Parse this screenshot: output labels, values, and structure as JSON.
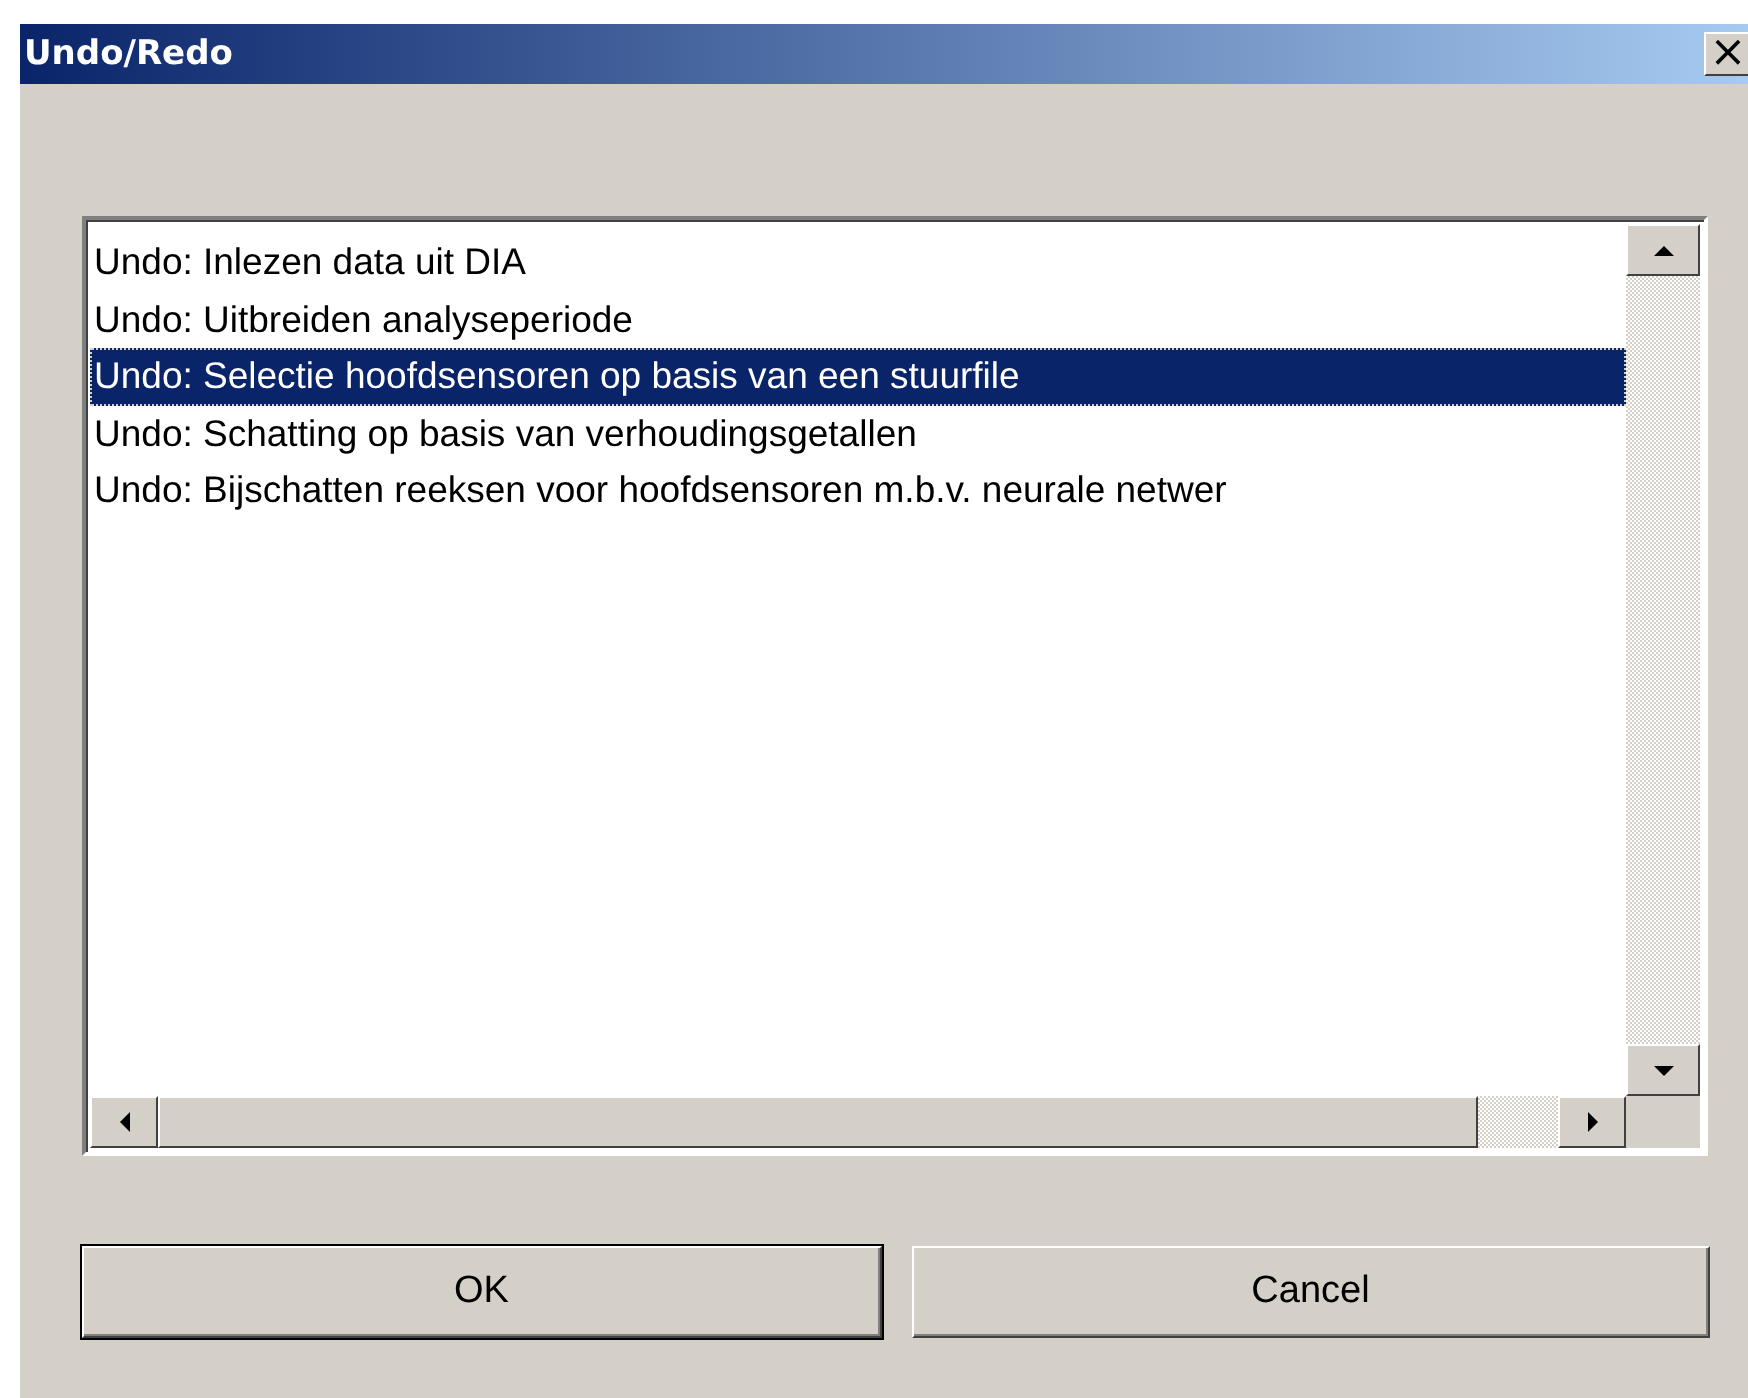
{
  "window": {
    "title": "Undo/Redo",
    "close": "×"
  },
  "list": {
    "items": [
      {
        "label": "Undo: Inlezen data uit DIA",
        "selected": false
      },
      {
        "label": "Undo: Uitbreiden analyseperiode",
        "selected": false
      },
      {
        "label": "Undo: Selectie hoofdsensoren op basis van een stuurfile",
        "selected": true
      },
      {
        "label": "Undo: Schatting op basis van verhoudingsgetallen",
        "selected": false
      },
      {
        "label": "Undo: Bijschatten reeksen voor hoofdsensoren m.b.v. neurale netwer",
        "selected": false
      }
    ]
  },
  "buttons": [
    {
      "label": "OK",
      "default": true
    },
    {
      "label": "Cancel",
      "default": false
    }
  ]
}
